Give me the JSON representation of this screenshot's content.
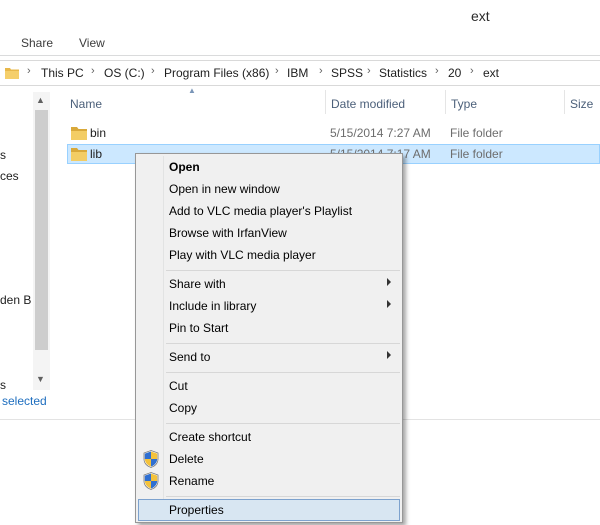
{
  "window": {
    "title": "ext"
  },
  "ribbon": {
    "tabs": [
      "Share",
      "View"
    ]
  },
  "address": {
    "crumbs": [
      "This PC",
      "OS (C:)",
      "Program Files (x86)",
      "IBM",
      "SPSS",
      "Statistics",
      "20",
      "ext"
    ]
  },
  "nav": {
    "fragments": [
      "s",
      "ces",
      "den B",
      "s"
    ],
    "status": "selected"
  },
  "columns": {
    "name": "Name",
    "date": "Date modified",
    "type": "Type",
    "size": "Size"
  },
  "files": [
    {
      "name": "bin",
      "date": "5/15/2014 7:27 AM",
      "type": "File folder"
    },
    {
      "name": "lib",
      "date": "5/15/2014 7:17 AM",
      "type": "File folder"
    }
  ],
  "context_menu": {
    "items": [
      {
        "label": "Open",
        "bold": true
      },
      {
        "label": "Open in new window"
      },
      {
        "label": "Add to VLC media player's Playlist"
      },
      {
        "label": "Browse with IrfanView"
      },
      {
        "label": "Play with VLC media player"
      },
      {
        "label": "Share with",
        "submenu": true
      },
      {
        "label": "Include in library",
        "submenu": true
      },
      {
        "label": "Pin to Start"
      },
      {
        "label": "Send to",
        "submenu": true
      },
      {
        "label": "Cut"
      },
      {
        "label": "Copy"
      },
      {
        "label": "Create shortcut"
      },
      {
        "label": "Delete",
        "icon": "uac-shield-icon"
      },
      {
        "label": "Rename",
        "icon": "uac-shield-icon"
      },
      {
        "label": "Properties",
        "highlighted": true
      }
    ]
  },
  "colors": {
    "folder": "#e8b84a",
    "selection": "#cce8ff",
    "menu_bg": "#f0f0f0",
    "menu_highlight": "#d8e6f2",
    "status_text": "#1e6ebf"
  }
}
